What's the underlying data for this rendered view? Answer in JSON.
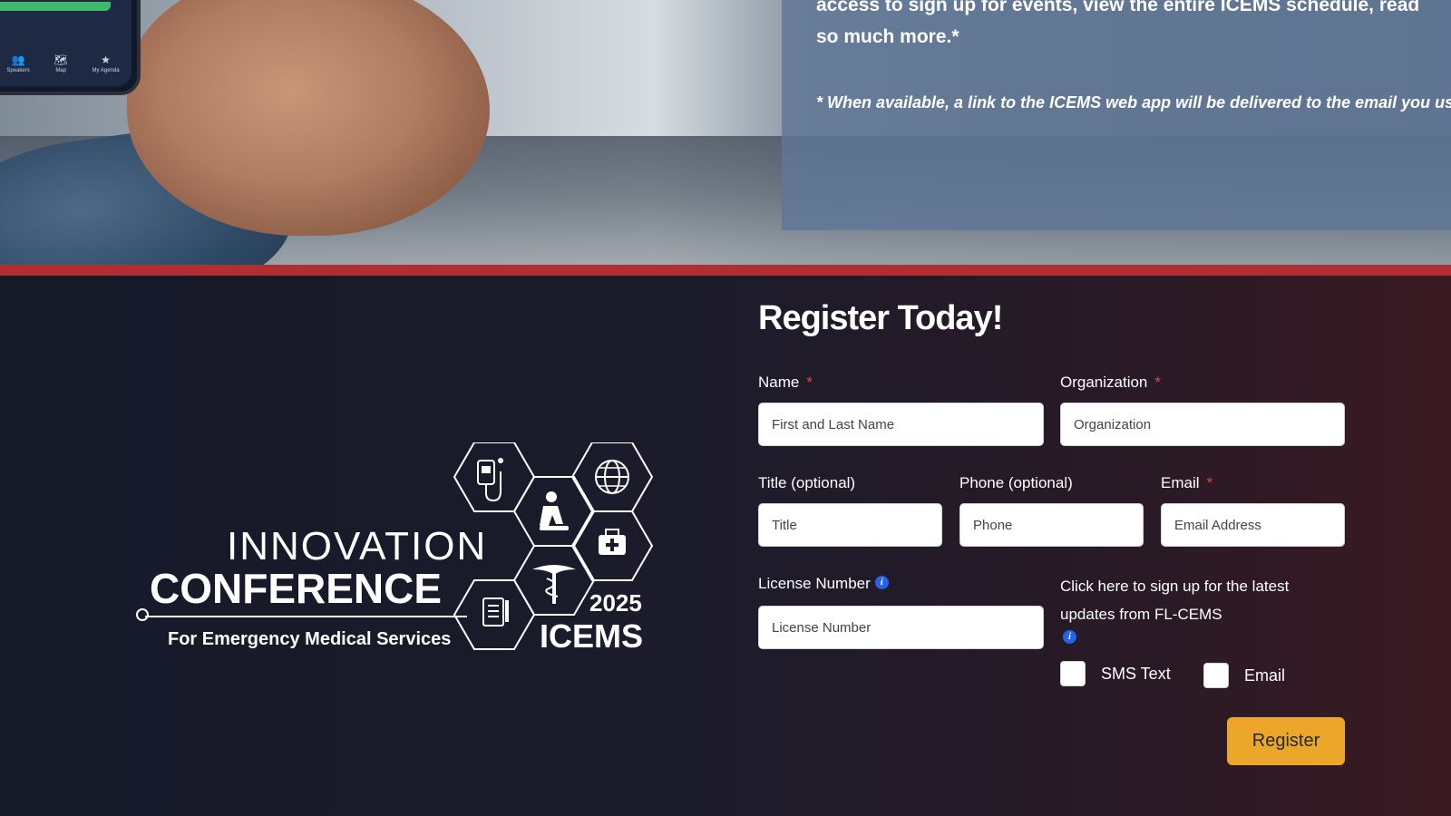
{
  "hero": {
    "line1": "access to sign up for events, view the entire ICEMS schedule, read",
    "line2": "so much more.*",
    "note": "* When available, a link to the ICEMS web app will be delivered to the email you use to"
  },
  "phone": {
    "nav": [
      {
        "icon": "people-icon",
        "glyph": "👥",
        "label": "Speakers"
      },
      {
        "icon": "map-icon",
        "glyph": "🗺",
        "label": "Map"
      },
      {
        "icon": "star-icon",
        "glyph": "★",
        "label": "My Agenda"
      }
    ]
  },
  "logo": {
    "line1": "INNOVATION",
    "line2": "CONFERENCE",
    "line3": "For Emergency Medical Services",
    "year": "2025",
    "acronym": "ICEMS"
  },
  "form": {
    "title": "Register Today!",
    "name_label": "Name",
    "name_placeholder": "First and Last Name",
    "org_label": "Organization",
    "org_placeholder": "Organization",
    "title_label": "Title (optional)",
    "title_placeholder": "Title",
    "phone_label": "Phone (optional)",
    "phone_placeholder": "Phone",
    "email_label": "Email",
    "email_placeholder": "Email Address",
    "license_label": "License Number",
    "license_placeholder": "License Number",
    "required_mark": "*",
    "info_glyph": "i",
    "signup_text": "Click here to sign up for the latest updates from FL-CEMS",
    "sms_label": "SMS Text",
    "email_opt_label": "Email",
    "register_label": "Register"
  },
  "colors": {
    "accent_red": "#b12e33",
    "button": "#eca72a",
    "info_blue": "#2563eb"
  }
}
